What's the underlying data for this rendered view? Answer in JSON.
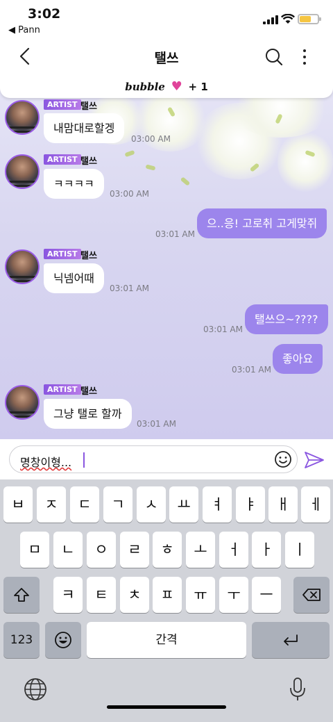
{
  "status_bar": {
    "time": "3:02",
    "back_app": "◀ Pann",
    "battery_color": "#f5c542"
  },
  "nav": {
    "title": "탤쓰",
    "back_icon": "chevron-left-icon",
    "search_icon": "search-icon",
    "more_icon": "more-vertical-icon"
  },
  "banner": {
    "logo": "bubble",
    "heart": "♥",
    "count": "+ 1",
    "heart_color": "#e0449a"
  },
  "artist_tag": "ARTIST",
  "messages": [
    {
      "tag": "ARTIST",
      "sender": "탤쓰",
      "text": "내맘대로할겡",
      "time": "03:00 AM"
    },
    {
      "tag": "ARTIST",
      "sender": "탤쓰",
      "text": "ㅋㅋㅋㅋ",
      "time": "03:00 AM"
    },
    {
      "text": "으..응! 고로취 고게맞쥐",
      "time": "03:01 AM"
    },
    {
      "tag": "ARTIST",
      "sender": "탤쓰",
      "text": "닉넴어때",
      "time": "03:01 AM"
    },
    {
      "text": "탤쓰으~????",
      "time": "03:01 AM"
    },
    {
      "text": "좋아요",
      "time": "03:01 AM"
    },
    {
      "tag": "ARTIST",
      "sender": "탤쓰",
      "text": "그냥 탤로 할까",
      "time": "03:01 AM"
    }
  ],
  "colors": {
    "outgoing_bubble": "#9c85ec",
    "accent": "#8a56e0"
  },
  "input": {
    "value": "명창이형..."
  },
  "keyboard": {
    "row1": [
      "ㅂ",
      "ㅈ",
      "ㄷ",
      "ㄱ",
      "ㅅ",
      "ㅛ",
      "ㅕ",
      "ㅑ",
      "ㅐ",
      "ㅔ"
    ],
    "row2": [
      "ㅁ",
      "ㄴ",
      "ㅇ",
      "ㄹ",
      "ㅎ",
      "ㅗ",
      "ㅓ",
      "ㅏ",
      "ㅣ"
    ],
    "row3": [
      "ㅋ",
      "ㅌ",
      "ㅊ",
      "ㅍ",
      "ㅠ",
      "ㅜ",
      "ㅡ"
    ],
    "numbers_label": "123",
    "space_label": "간격"
  }
}
